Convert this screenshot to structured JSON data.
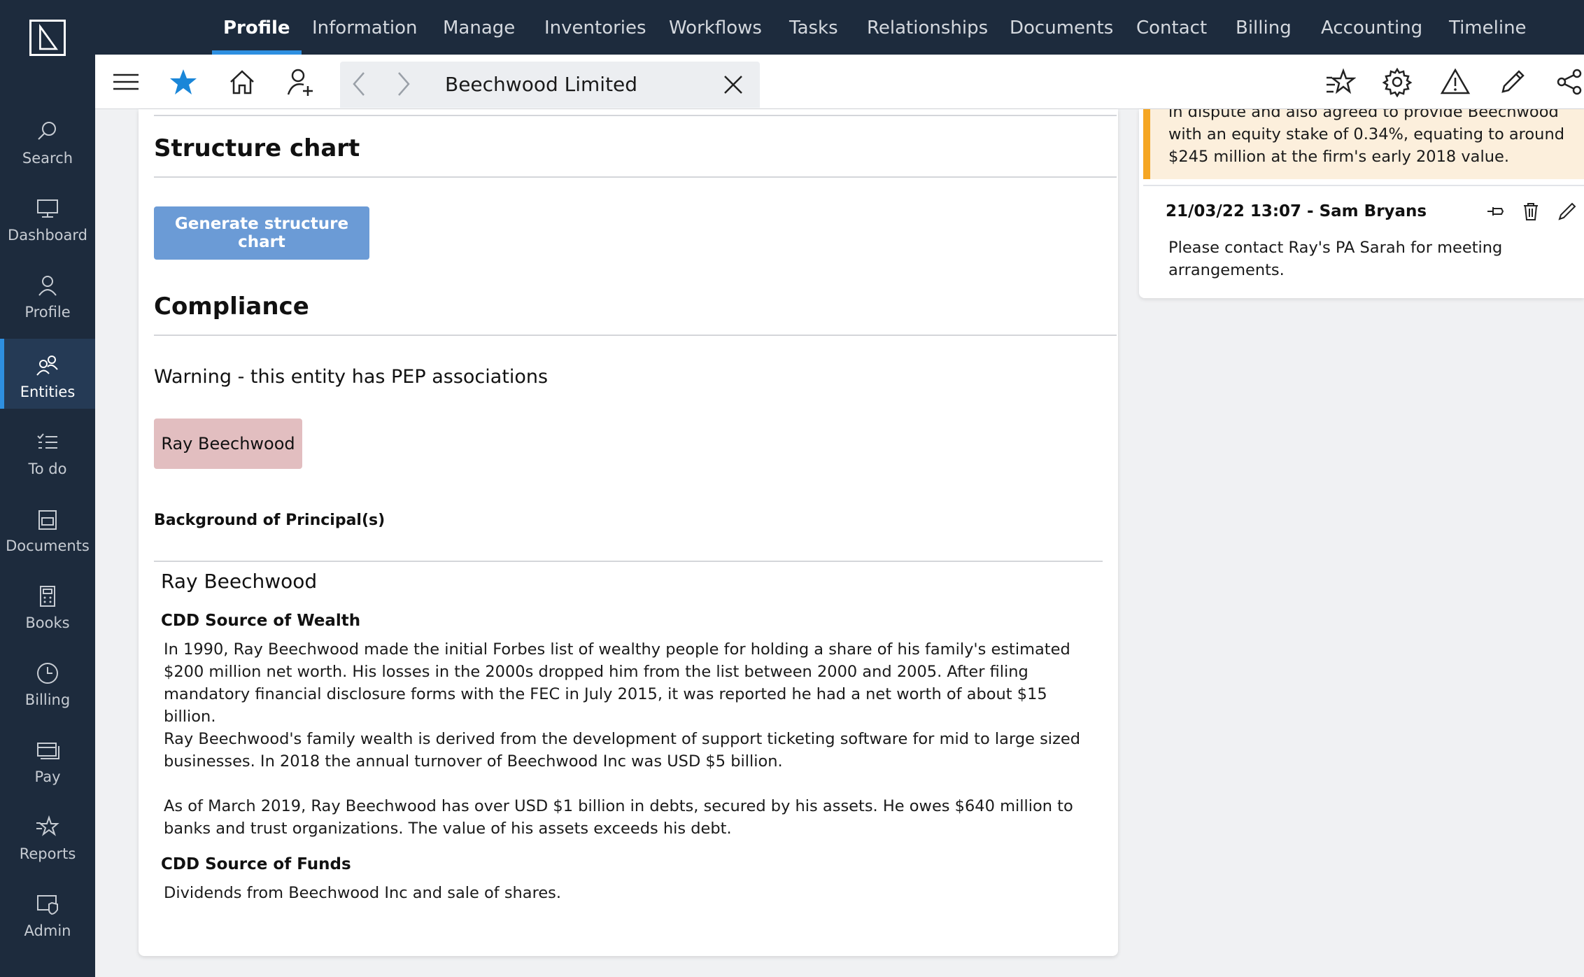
{
  "sidebar": {
    "items": [
      {
        "label": "Search",
        "icon": "search-icon"
      },
      {
        "label": "Dashboard",
        "icon": "dashboard-icon"
      },
      {
        "label": "Profile",
        "icon": "profile-icon"
      },
      {
        "label": "Entities",
        "icon": "entities-icon",
        "active": true
      },
      {
        "label": "To do",
        "icon": "todo-icon"
      },
      {
        "label": "Documents",
        "icon": "documents-icon"
      },
      {
        "label": "Books",
        "icon": "books-icon"
      },
      {
        "label": "Billing",
        "icon": "billing-icon"
      },
      {
        "label": "Pay",
        "icon": "pay-icon"
      },
      {
        "label": "Reports",
        "icon": "reports-icon"
      },
      {
        "label": "Admin",
        "icon": "admin-icon"
      }
    ]
  },
  "topnav": {
    "tabs": [
      "Profile",
      "Information",
      "Manage",
      "Inventories",
      "Workflows",
      "Tasks",
      "Relationships",
      "Documents",
      "Contact",
      "Billing",
      "Accounting",
      "Timeline"
    ],
    "active": "Profile"
  },
  "toolbar": {
    "entity_tab_title": "Beechwood Limited"
  },
  "main": {
    "structure_chart_title": "Structure chart",
    "generate_button_label": "Generate structure chart",
    "compliance_title": "Compliance",
    "warning_text": "Warning - this entity has PEP associations",
    "pep_person": "Ray Beechwood",
    "background_label": "Background of Principal(s)",
    "principal": {
      "name": "Ray Beechwood",
      "wealth_heading": "CDD Source of Wealth",
      "wealth_paragraphs": [
        "In 1990, Ray Beechwood made the initial Forbes list of wealthy people for holding a share of his family's estimated $200 million net worth. His losses in the 2000s dropped him from the list between 2000 and 2005. After filing mandatory financial disclosure forms with the FEC in July 2015, it was reported he had a net worth of about $15 billion.",
        "Ray Beechwood's family wealth is derived from the development of support ticketing software for mid to large sized businesses. In 2018 the annual turnover of Beechwood Inc was USD $5 billion.",
        "As of March 2019, Ray Beechwood has over USD $1 billion in debts, secured by his assets. He owes $640 million to banks and trust organizations. The value of his assets exceeds his debt."
      ],
      "funds_heading": "CDD Source of Funds",
      "funds_text": "Dividends from Beechwood Inc and sale of shares."
    }
  },
  "notes": {
    "highlight_text": "in dispute and also agreed to provide Beechwood with an equity stake of 0.34%, equating to around $245 million at the firm's early 2018 value.",
    "note_meta": "21/03/22 13:07  -  Sam Bryans",
    "note_body": "Please contact Ray's PA Sarah for meeting arrangements."
  },
  "colors": {
    "sidebar_bg": "#1d2b3d",
    "accent": "#2e8fe0",
    "button_blue": "#6b9bd6",
    "pep_chip": "#e2bec0",
    "note_accent": "#f5a623"
  }
}
